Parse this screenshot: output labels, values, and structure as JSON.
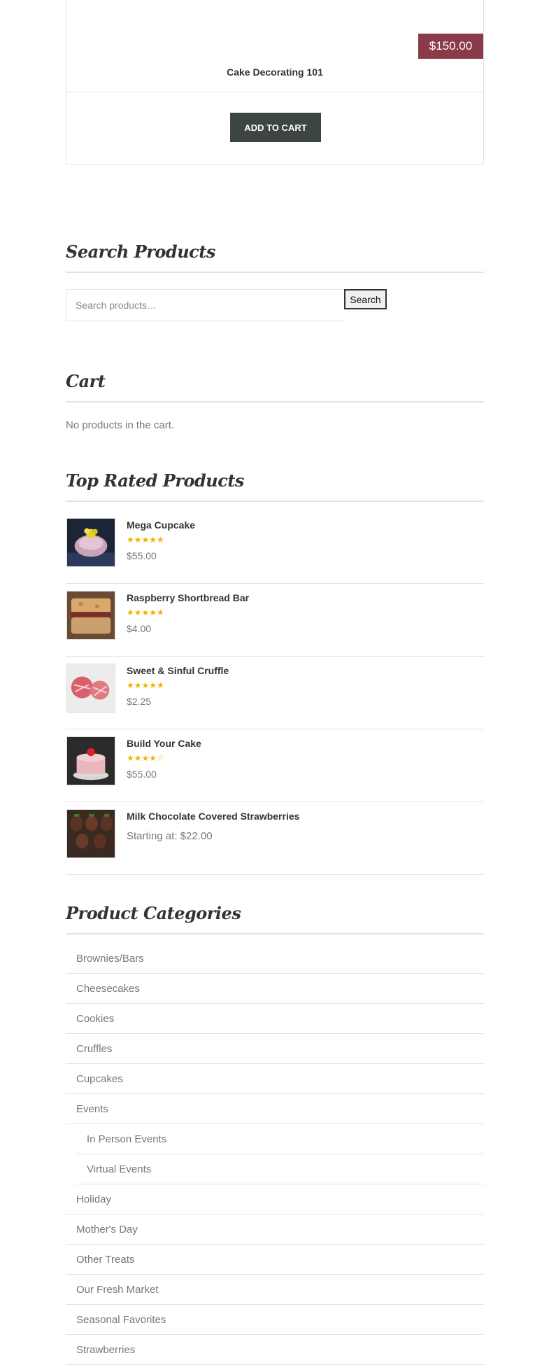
{
  "product": {
    "price": "$150.00",
    "title": "Cake Decorating 101",
    "add_to_cart": "ADD TO CART"
  },
  "search": {
    "heading": "Search Products",
    "placeholder": "Search products…",
    "button": "Search"
  },
  "cart": {
    "heading": "Cart",
    "empty_message": "No products in the cart."
  },
  "top_rated": {
    "heading": "Top Rated Products",
    "items": [
      {
        "name": "Mega Cupcake",
        "stars": "★★★★★",
        "price": "$55.00",
        "icon": "cupcake-thumbnail"
      },
      {
        "name": "Raspberry Shortbread Bar",
        "stars": "★★★★★",
        "price": "$4.00",
        "icon": "shortbread-thumbnail"
      },
      {
        "name": "Sweet & Sinful Cruffle",
        "stars": "★★★★★",
        "price": "$2.25",
        "icon": "cruffle-thumbnail"
      },
      {
        "name": "Build Your Cake",
        "stars": "★★★★☆",
        "price": "$55.00",
        "icon": "cake-thumbnail"
      },
      {
        "name": "Milk Chocolate Covered Strawberries",
        "stars": "",
        "price": "Starting at: $22.00",
        "icon": "strawberries-thumbnail"
      }
    ]
  },
  "categories": {
    "heading": "Product Categories",
    "items": [
      "Brownies/Bars",
      "Cheesecakes",
      "Cookies",
      "Cruffles",
      "Cupcakes",
      "Events",
      "In Person Events",
      "Virtual Events",
      "Holiday",
      "Mother's Day",
      "Other Treats",
      "Our Fresh Market",
      "Seasonal Favorites",
      "Strawberries"
    ]
  },
  "colors": {
    "price_badge": "#8b3a4a",
    "button": "#3c4543",
    "star": "#f0b400"
  }
}
